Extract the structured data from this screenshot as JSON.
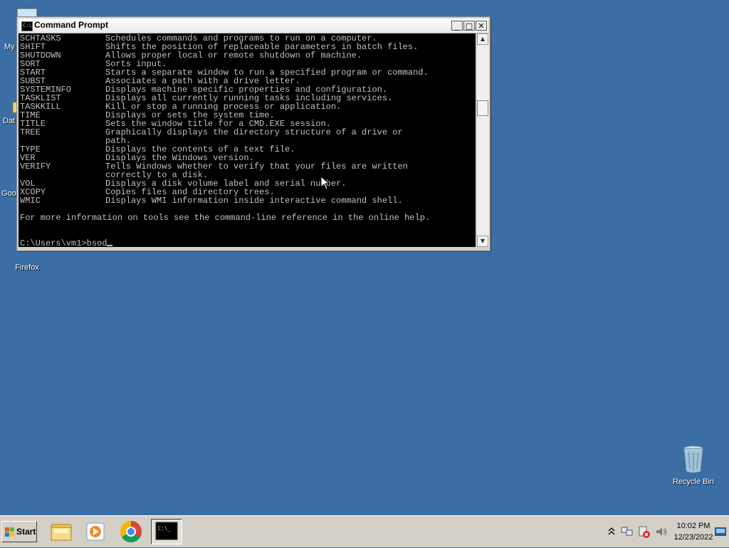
{
  "desktop": {
    "icons": [
      {
        "label": "My",
        "icon": "computer-icon"
      },
      {
        "label": "Dat",
        "icon": "folder-icon"
      },
      {
        "label": "Goo",
        "icon": "chrome-icon"
      },
      {
        "label": "Firefox",
        "icon": "firefox-icon"
      },
      {
        "label": "Recycle Bin",
        "icon": "recycle-bin-icon"
      }
    ]
  },
  "window": {
    "title": "Command Prompt",
    "icon": "cmd-icon",
    "buttons": {
      "minimize": "_",
      "maximize": "□",
      "close": "✕"
    },
    "colors": {
      "console_bg": "#000000",
      "console_fg": "#c0c0c0"
    },
    "lines": [
      {
        "cmd": "SCHTASKS",
        "desc": "Schedules commands and programs to run on a computer."
      },
      {
        "cmd": "SHIFT",
        "desc": "Shifts the position of replaceable parameters in batch files."
      },
      {
        "cmd": "SHUTDOWN",
        "desc": "Allows proper local or remote shutdown of machine."
      },
      {
        "cmd": "SORT",
        "desc": "Sorts input."
      },
      {
        "cmd": "START",
        "desc": "Starts a separate window to run a specified program or command."
      },
      {
        "cmd": "SUBST",
        "desc": "Associates a path with a drive letter."
      },
      {
        "cmd": "SYSTEMINFO",
        "desc": "Displays machine specific properties and configuration."
      },
      {
        "cmd": "TASKLIST",
        "desc": "Displays all currently running tasks including services."
      },
      {
        "cmd": "TASKKILL",
        "desc": "Kill or stop a running process or application."
      },
      {
        "cmd": "TIME",
        "desc": "Displays or sets the system time."
      },
      {
        "cmd": "TITLE",
        "desc": "Sets the window title for a CMD.EXE session."
      },
      {
        "cmd": "TREE",
        "desc": "Graphically displays the directory structure of a drive or"
      },
      {
        "cmd": "",
        "desc": "path."
      },
      {
        "cmd": "TYPE",
        "desc": "Displays the contents of a text file."
      },
      {
        "cmd": "VER",
        "desc": "Displays the Windows version."
      },
      {
        "cmd": "VERIFY",
        "desc": "Tells Windows whether to verify that your files are written"
      },
      {
        "cmd": "",
        "desc": "correctly to a disk."
      },
      {
        "cmd": "VOL",
        "desc": "Displays a disk volume label and serial number."
      },
      {
        "cmd": "XCOPY",
        "desc": "Copies files and directory trees."
      },
      {
        "cmd": "WMIC",
        "desc": "Displays WMI information inside interactive command shell."
      }
    ],
    "footer": "For more information on tools see the command-line reference in the online help.",
    "prompt": "C:\\Users\\vm1>",
    "input": "bsod"
  },
  "taskbar": {
    "start_label": "Start",
    "items": [
      {
        "name": "explorer",
        "icon": "folder-icon"
      },
      {
        "name": "media-player",
        "icon": "media-player-icon"
      },
      {
        "name": "chrome",
        "icon": "chrome-icon"
      },
      {
        "name": "command-prompt",
        "icon": "cmd-icon",
        "active": true
      }
    ],
    "tray_icons": [
      "chevron-up-icon",
      "network-icon",
      "action-center-icon",
      "volume-icon"
    ],
    "clock": {
      "time": "10:02 PM",
      "date": "12/23/2022"
    }
  }
}
